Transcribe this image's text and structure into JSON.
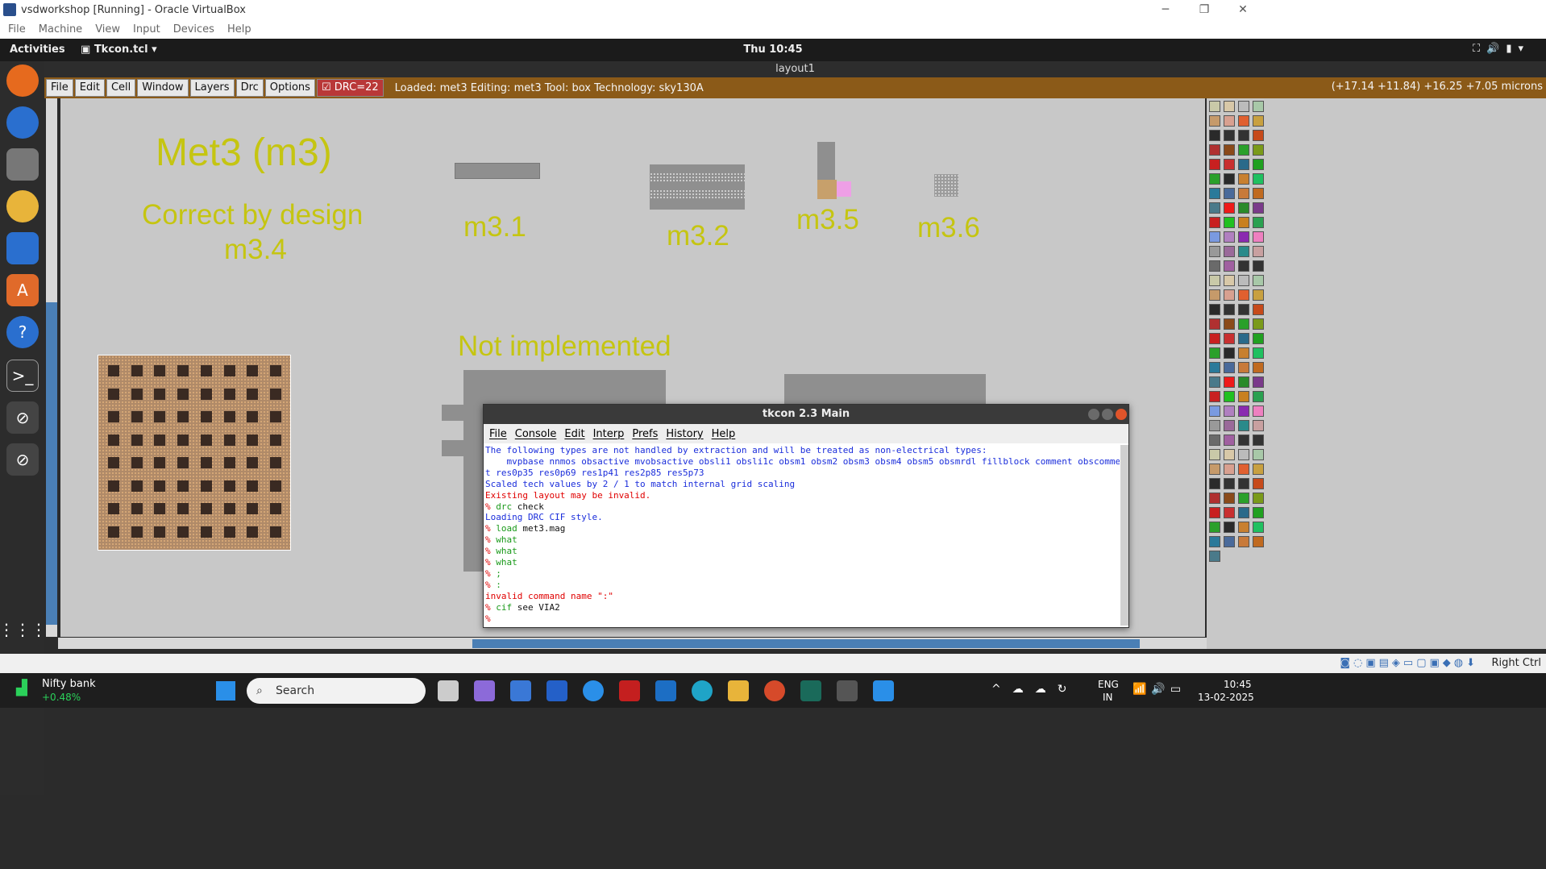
{
  "host": {
    "title": "vsdworkshop [Running] - Oracle VirtualBox",
    "menu": [
      "File",
      "Machine",
      "View",
      "Input",
      "Devices",
      "Help"
    ],
    "right_ctrl": "Right Ctrl"
  },
  "guest_topbar": {
    "activities": "Activities",
    "app": "Tkcon.tcl",
    "clock": "Thu 10:45"
  },
  "layout_window": {
    "title": "layout1",
    "menus": [
      "File",
      "Edit",
      "Cell",
      "Window",
      "Layers",
      "Drc",
      "Options"
    ],
    "drc_label": "DRC=22",
    "status": "Loaded: met3 Editing: met3 Tool: box  Technology: sky130A",
    "coords": "(+17.14 +11.84) +16.25 +7.05 microns"
  },
  "canvas_labels": {
    "title": "Met3 (m3)",
    "correct": "Correct by design",
    "m34": "m3.4",
    "m31": "m3.1",
    "m32": "m3.2",
    "m35": "m3.5",
    "m36": "m3.6",
    "not_impl": "Not implemented"
  },
  "tkcon": {
    "title": "tkcon 2.3 Main",
    "menu": [
      "File",
      "Console",
      "Edit",
      "Interp",
      "Prefs",
      "History",
      "Help"
    ],
    "lines": [
      {
        "t": "The following types are not handled by extraction and will be treated as non-electrical types:",
        "c": "blue"
      },
      {
        "t": "    mvpbase nnmos obsactive mvobsactive obsli1 obsli1c obsm1 obsm2 obsm3 obsm4 obsm5 obsmrdl fillblock comment obscommen",
        "c": "blue"
      },
      {
        "t": "t res0p35 res0p69 res1p41 res2p85 res5p73",
        "c": "blue"
      },
      {
        "t": "Scaled tech values by 2 / 1 to match internal grid scaling",
        "c": "blue"
      },
      {
        "t": "Existing layout may be invalid.",
        "c": "red"
      },
      {
        "t": "% drc check",
        "c": "cmd"
      },
      {
        "t": "Loading DRC CIF style.",
        "c": "blue"
      },
      {
        "t": "% load met3.mag",
        "c": "cmd"
      },
      {
        "t": "% what",
        "c": "cmd"
      },
      {
        "t": "% what",
        "c": "cmd"
      },
      {
        "t": "% what",
        "c": "cmd"
      },
      {
        "t": "% ;",
        "c": "cmd"
      },
      {
        "t": "% :",
        "c": "cmd"
      },
      {
        "t": "invalid command name \":\"",
        "c": "red"
      },
      {
        "t": "% cif see VIA2",
        "c": "cmd"
      },
      {
        "t": "%",
        "c": "cmd"
      }
    ]
  },
  "taskbar": {
    "stock_name": "Nifty bank",
    "stock_change": "+0.48%",
    "search": "Search",
    "lang1": "ENG",
    "lang2": "IN",
    "time": "10:45",
    "date": "13-02-2025"
  },
  "colors": {
    "label_yellow": "#c5c511",
    "toolbar_brown": "#8b5a18",
    "accent_blue": "#4a7fb5"
  }
}
